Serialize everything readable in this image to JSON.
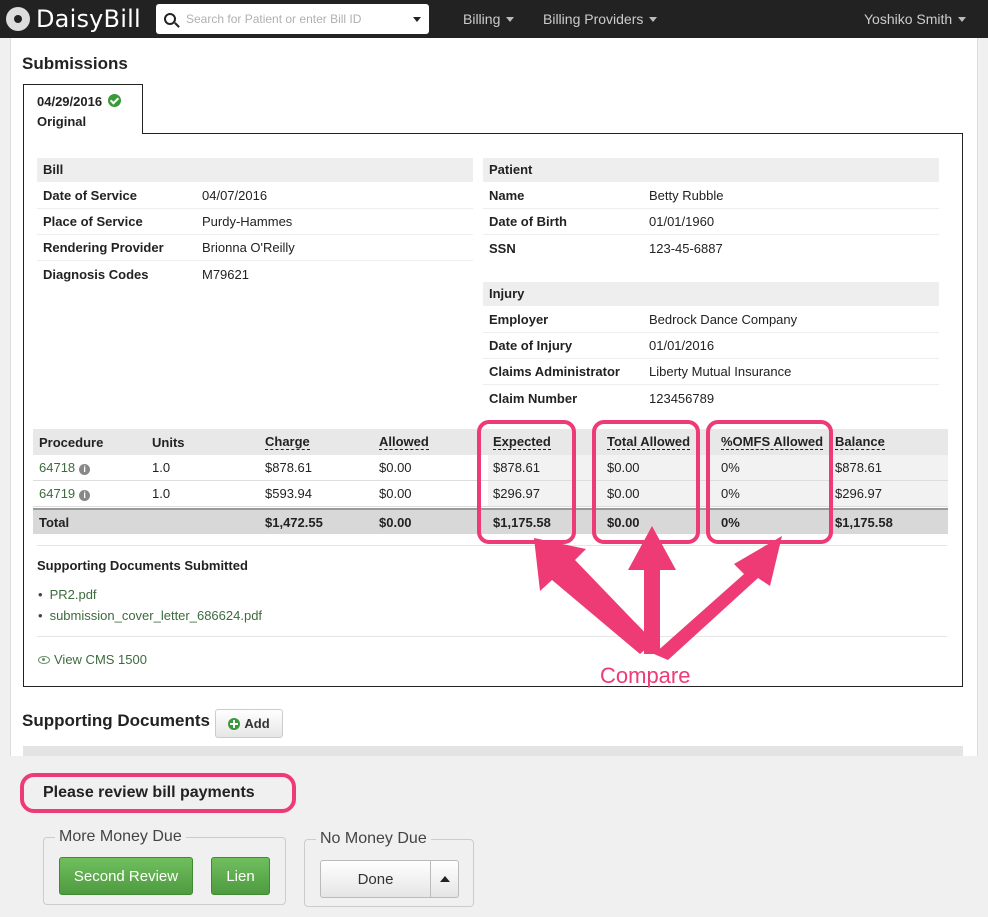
{
  "navbar": {
    "brand": "DaisyBill",
    "search_placeholder": "Search for Patient or enter Bill ID",
    "menu": [
      "Billing",
      "Billing Providers"
    ],
    "user": "Yoshiko Smith"
  },
  "submissions": {
    "title": "Submissions",
    "tab": {
      "date": "04/29/2016",
      "label": "Original"
    }
  },
  "bill": {
    "header": "Bill",
    "rows": [
      {
        "label": "Date of Service",
        "value": "04/07/2016"
      },
      {
        "label": "Place of Service",
        "value": "Purdy-Hammes"
      },
      {
        "label": "Rendering Provider",
        "value": "Brionna O'Reilly"
      },
      {
        "label": "Diagnosis Codes",
        "value": "M79621"
      }
    ]
  },
  "patient": {
    "header": "Patient",
    "rows": [
      {
        "label": "Name",
        "value": "Betty Rubble"
      },
      {
        "label": "Date of Birth",
        "value": "01/01/1960"
      },
      {
        "label": "SSN",
        "value": "123-45-6887"
      }
    ]
  },
  "injury": {
    "header": "Injury",
    "rows": [
      {
        "label": "Employer",
        "value": "Bedrock Dance Company"
      },
      {
        "label": "Date of Injury",
        "value": "01/01/2016"
      },
      {
        "label": "Claims Administrator",
        "value": "Liberty Mutual Insurance"
      },
      {
        "label": "Claim Number",
        "value": "123456789"
      }
    ]
  },
  "procedures": {
    "columns": [
      "Procedure",
      "Units",
      "Charge",
      "Allowed",
      "Expected",
      "Total Allowed",
      "%OMFS Allowed",
      "Balance"
    ],
    "rows": [
      {
        "procedure": "64718",
        "units": "1.0",
        "charge": "$878.61",
        "allowed": "$0.00",
        "expected": "$878.61",
        "total_allowed": "$0.00",
        "omfs": "0%",
        "balance": "$878.61"
      },
      {
        "procedure": "64719",
        "units": "1.0",
        "charge": "$593.94",
        "allowed": "$0.00",
        "expected": "$296.97",
        "total_allowed": "$0.00",
        "omfs": "0%",
        "balance": "$296.97"
      }
    ],
    "total": {
      "label": "Total",
      "charge": "$1,472.55",
      "allowed": "$0.00",
      "expected": "$1,175.58",
      "total_allowed": "$0.00",
      "omfs": "0%",
      "balance": "$1,175.58"
    }
  },
  "supporting_submitted": {
    "title": "Supporting Documents Submitted",
    "files": [
      "PR2.pdf",
      "submission_cover_letter_686624.pdf"
    ],
    "view_cms": "View CMS 1500"
  },
  "annotation": {
    "text": "Compare",
    "color": "#ee3a75"
  },
  "supporting_documents": {
    "title": "Supporting Documents",
    "add_label": "Add"
  },
  "review": {
    "title": "Please review bill payments",
    "more_money": {
      "legend": "More Money Due",
      "second_review": "Second Review",
      "lien": "Lien"
    },
    "no_money": {
      "legend": "No Money Due",
      "done": "Done"
    }
  }
}
